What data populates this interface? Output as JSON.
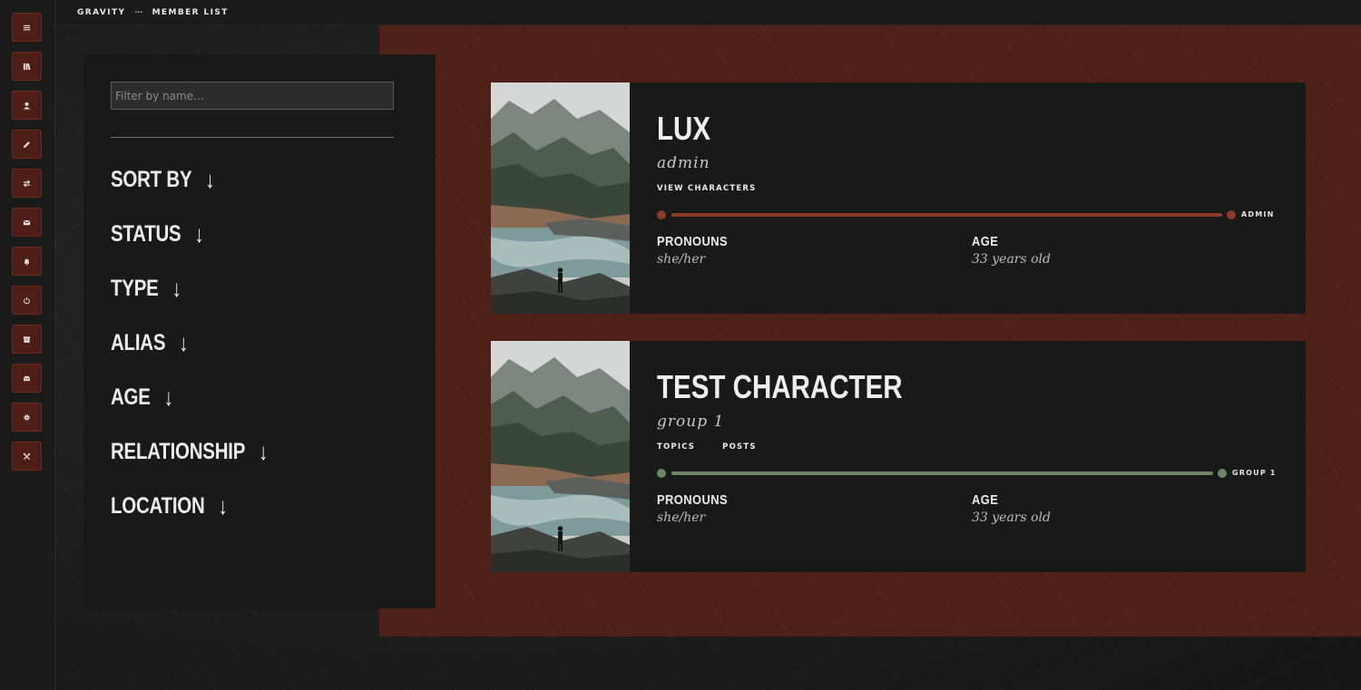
{
  "breadcrumb": {
    "site": "GRAVITY",
    "separator": "···",
    "page": "MEMBER LIST"
  },
  "rail": {
    "icons": [
      "menu-icon",
      "library-icon",
      "user-icon",
      "pencil-icon",
      "swap-icon",
      "envelope-icon",
      "bell-icon",
      "power-icon",
      "archive-icon",
      "discord-icon",
      "gear-icon",
      "tools-icon"
    ]
  },
  "filter": {
    "placeholder": "Filter by name...",
    "arrow": "↓",
    "sort_options": [
      "SORT BY",
      "STATUS",
      "TYPE",
      "ALIAS",
      "AGE",
      "RELATIONSHIP",
      "LOCATION"
    ]
  },
  "members": [
    {
      "name": "LUX",
      "group": "admin",
      "links": [
        "VIEW CHARACTERS"
      ],
      "group_label": "ADMIN",
      "group_color": "#8e3a2b",
      "fields": [
        {
          "label": "PRONOUNS",
          "value": "she/her"
        },
        {
          "label": "AGE",
          "value": "33 years old"
        }
      ]
    },
    {
      "name": "TEST CHARACTER",
      "group": "group 1",
      "links": [
        "TOPICS",
        "POSTS"
      ],
      "group_label": "GROUP 1",
      "group_color": "#6e8566",
      "fields": [
        {
          "label": "PRONOUNS",
          "value": "she/her"
        },
        {
          "label": "AGE",
          "value": "33 years old"
        }
      ]
    }
  ],
  "colors": {
    "accent_red": "#4d2118",
    "panel": "#191919",
    "rail_button": "#4e1e16"
  }
}
